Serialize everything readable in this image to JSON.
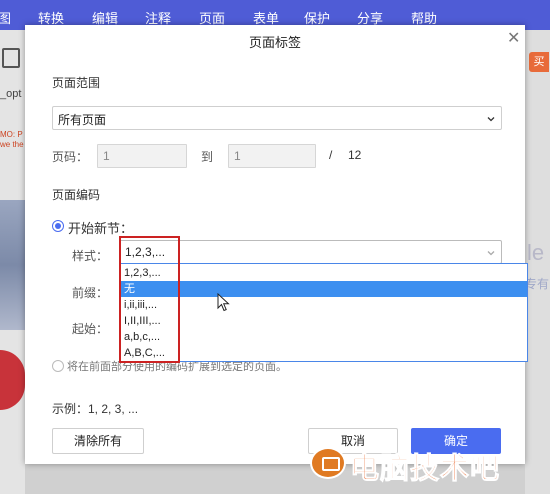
{
  "menubar": {
    "items": [
      "图",
      "转换",
      "编辑",
      "注释",
      "页面",
      "表单",
      "保护",
      "分享",
      "帮助"
    ],
    "active": "页面"
  },
  "background": {
    "file_name": "_opt",
    "red_text": "MO: P\nwe the",
    "right_pill": "买",
    "ghost_1": "le",
    "ghost_2": "专有"
  },
  "dialog": {
    "title": "页面标签",
    "page_range": {
      "label": "页面范围",
      "select_value": "所有页面",
      "page_num_label": "页码：",
      "from_value": "1",
      "to_label": "到",
      "to_value": "1",
      "total_sep": "/",
      "total": "12"
    },
    "page_numbering": {
      "label": "页面编码",
      "new_section_label": "开始新节：",
      "style_label": "样式：",
      "style_value": "1,2,3,...",
      "prefix_label": "前缀：",
      "start_label": "起始：",
      "style_options": [
        "1,2,3,...",
        "无",
        "i,ii,iii,...",
        "I,II,III,...",
        "a,b,c,...",
        "A,B,C,..."
      ],
      "selected_option_index": 1,
      "extend_label": "将在前面部分使用的编码扩展到选定的页面。"
    },
    "example": "示例：1, 2, 3, ...",
    "buttons": {
      "clear_all": "清除所有",
      "cancel": "取消",
      "ok": "确定"
    }
  },
  "watermark": {
    "text": "电脑技术吧"
  },
  "colors": {
    "menubar": "#4f5cd6",
    "primary": "#4a6cf0",
    "highlight": "#3c8ff0",
    "annotation_red": "#cc2222",
    "watermark": "#e85a1a"
  }
}
